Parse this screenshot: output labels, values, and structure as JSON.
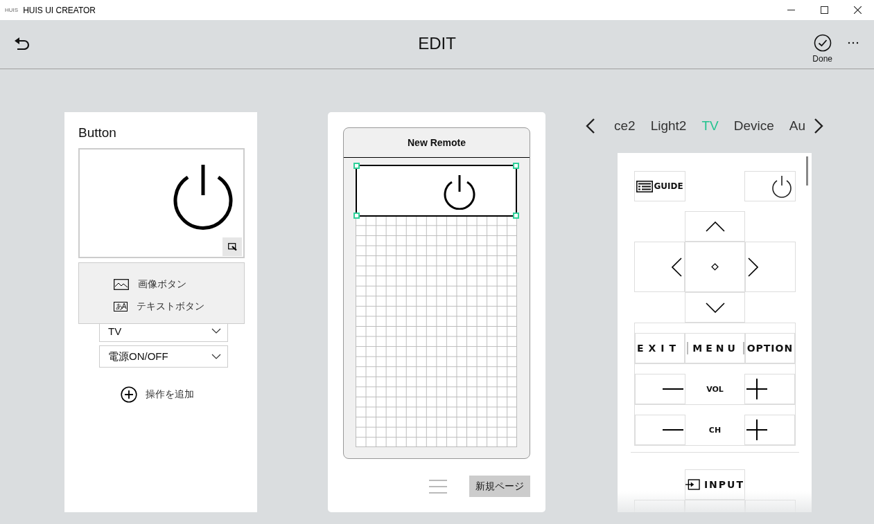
{
  "window": {
    "logo": "HUIS",
    "title": "HUIS UI CREATOR"
  },
  "header": {
    "title": "EDIT",
    "done_label": "Done"
  },
  "properties": {
    "title": "Button",
    "menu": [
      {
        "kind": "image",
        "label": "画像ボタン"
      },
      {
        "kind": "text",
        "label": "テキストボタン",
        "icon_text": "あA"
      }
    ],
    "dropdowns": [
      {
        "value": "TV"
      },
      {
        "value": "電源ON/OFF"
      }
    ],
    "add_label": "操作を追加"
  },
  "editor": {
    "remote_title": "New Remote",
    "new_page_label": "新規ページ"
  },
  "device_tabs": [
    {
      "label": "ce2",
      "selected": false
    },
    {
      "label": "Light2",
      "selected": false
    },
    {
      "label": "TV",
      "selected": true
    },
    {
      "label": "Device",
      "selected": false
    },
    {
      "label": "Au",
      "selected": false
    }
  ],
  "remote_rows": [
    {
      "buttons": [
        {
          "kind": "guide",
          "label": "GUIDE"
        },
        {
          "kind": "power"
        }
      ]
    },
    {
      "buttons": [
        {
          "kind": "up"
        }
      ]
    },
    {
      "buttons": [
        {
          "kind": "left"
        },
        {
          "kind": "center"
        },
        {
          "kind": "right"
        }
      ]
    },
    {
      "buttons": [
        {
          "kind": "down"
        }
      ]
    },
    {
      "group": true,
      "buttons": [
        {
          "kind": "spaced",
          "label": "EXIT"
        },
        {
          "kind": "spaced",
          "label": "MENU"
        },
        {
          "kind": "text",
          "label": "OPTION"
        }
      ]
    },
    {
      "group": true,
      "buttons": [
        {
          "kind": "minus"
        },
        {
          "kind": "label",
          "label": "VOL"
        },
        {
          "kind": "plus"
        }
      ]
    },
    {
      "group": true,
      "buttons": [
        {
          "kind": "minus"
        },
        {
          "kind": "label",
          "label": "CH"
        },
        {
          "kind": "plus"
        }
      ]
    },
    {
      "divider": true,
      "buttons": []
    },
    {
      "buttons": [
        {
          "kind": "input",
          "label": "INPUT"
        }
      ]
    },
    {
      "buttons": [
        {
          "kind": "blank"
        },
        {
          "kind": "blank"
        },
        {
          "kind": "blank"
        }
      ]
    }
  ]
}
